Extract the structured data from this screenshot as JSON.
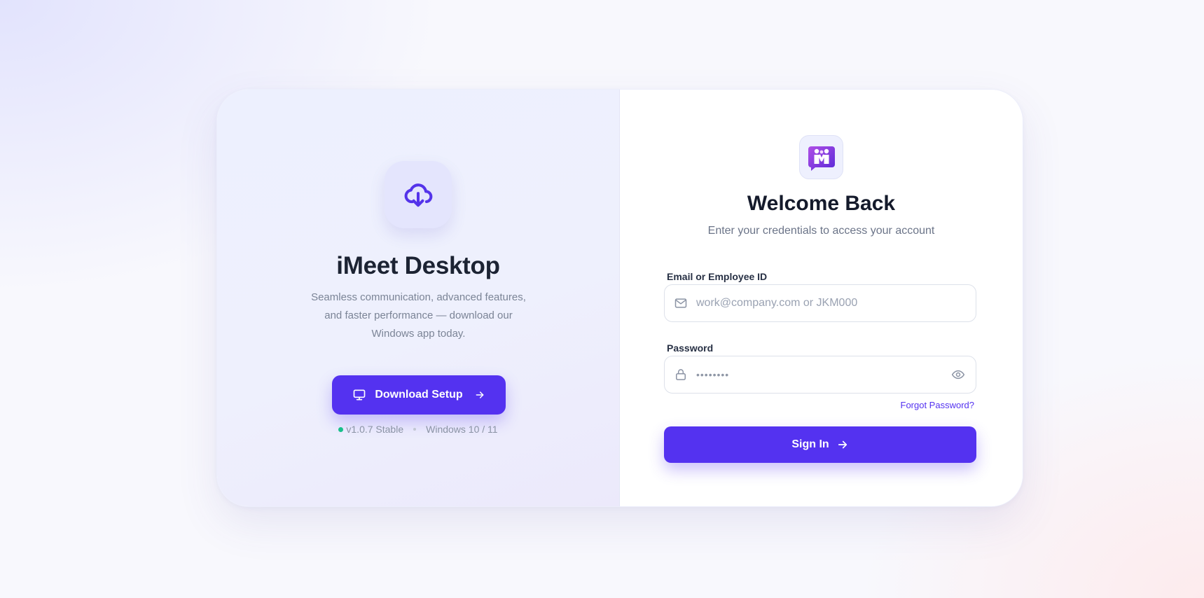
{
  "left_panel": {
    "icon": "cloud-download-icon",
    "title": "iMeet Desktop",
    "description": "Seamless communication, advanced features, and faster performance — download our Windows app today.",
    "download_button": {
      "label": "Download Setup",
      "leading_icon": "monitor-icon",
      "trailing_icon": "arrow-right-icon"
    },
    "version": "v1.0.7 Stable",
    "platform": "Windows 10 / 11"
  },
  "right_panel": {
    "logo": "imeet-logo",
    "title": "Welcome Back",
    "subtitle": "Enter your credentials to access your account",
    "email": {
      "label": "Email or Employee ID",
      "placeholder": "work@company.com or JKM000",
      "value": "",
      "icon": "mail-icon"
    },
    "password": {
      "label": "Password",
      "value_masked": "••••••••",
      "icon": "lock-icon",
      "toggle_icon": "eye-icon"
    },
    "forgot_password": "Forgot Password?",
    "sign_in_button": {
      "label": "Sign In",
      "trailing_icon": "arrow-right-icon"
    }
  },
  "colors": {
    "primary": "#5432f0",
    "status_green": "#18c08a",
    "title_text": "#141a2b",
    "muted_text": "#6b7488"
  }
}
